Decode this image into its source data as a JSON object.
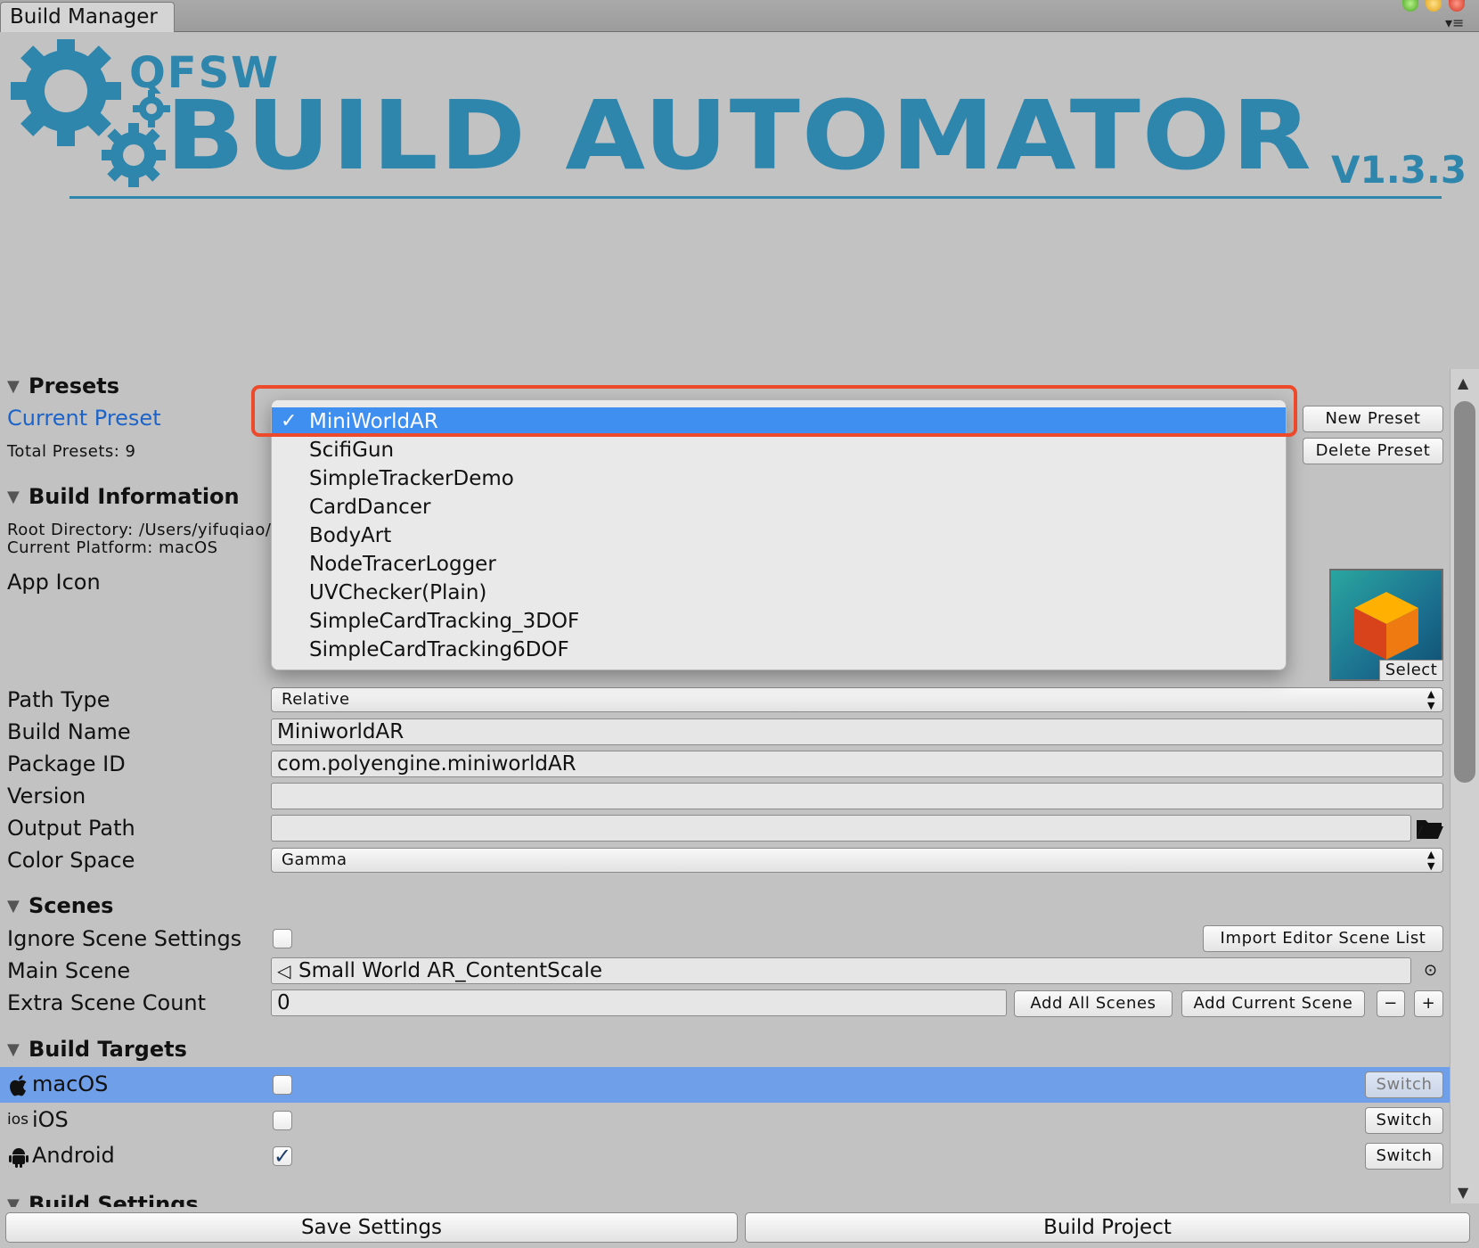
{
  "window": {
    "tab_title": "Build Manager",
    "menu_glyph": "▾≡"
  },
  "banner": {
    "brand": "QFSW",
    "title": "BUILD AUTOMATOR",
    "version": "V1.3.3",
    "color": "#2f86ad"
  },
  "presets": {
    "header": "Presets",
    "current_label": "Current Preset",
    "total_label": "Total Presets: 9",
    "new_button": "New Preset",
    "delete_button": "Delete Preset",
    "dropdown": {
      "selected": "MiniWorldAR",
      "check_glyph": "✓",
      "options": [
        "MiniWorldAR",
        "ScifiGun",
        "SimpleTrackerDemo",
        "CardDancer",
        "BodyArt",
        "NodeTracerLogger",
        "UVChecker(Plain)",
        "SimpleCardTracking_3DOF",
        "SimpleCardTracking6DOF"
      ],
      "highlight_color": "#3f8ff0",
      "callout_color": "#ec4a2b"
    }
  },
  "build_info": {
    "header": "Build Information",
    "root_directory": "Root Directory: /Users/yifuqiao/",
    "current_platform": "Current Platform: macOS",
    "app_icon_label": "App Icon",
    "app_icon_select": "Select"
  },
  "fields": {
    "path_type": {
      "label": "Path Type",
      "value": "Relative"
    },
    "build_name": {
      "label": "Build Name",
      "value": "MiniworldAR"
    },
    "package_id": {
      "label": "Package ID",
      "value": "com.polyengine.miniworldAR"
    },
    "version": {
      "label": "Version",
      "value": ""
    },
    "output_path": {
      "label": "Output Path",
      "value": ""
    },
    "color_space": {
      "label": "Color Space",
      "value": "Gamma"
    }
  },
  "scenes": {
    "header": "Scenes",
    "ignore_label": "Ignore Scene Settings",
    "ignore_checked": false,
    "import_button": "Import Editor Scene List",
    "main_scene_label": "Main Scene",
    "main_scene_value": "Small World AR_ContentScale",
    "extra_count_label": "Extra Scene Count",
    "extra_count_value": "0",
    "add_all_button": "Add All Scenes",
    "add_current_button": "Add Current Scene",
    "minus_button": "−",
    "plus_button": "+"
  },
  "build_targets": {
    "header": "Build Targets",
    "switch_label": "Switch",
    "selected_row_color": "#6f9fe8",
    "items": [
      {
        "name": "macOS",
        "icon": "apple-icon",
        "glyph": "",
        "checked": false,
        "selected": true
      },
      {
        "name": "iOS",
        "icon": "ios-icon",
        "glyph": "ios",
        "checked": false,
        "selected": false
      },
      {
        "name": "Android",
        "icon": "android-icon",
        "glyph": "",
        "checked": true,
        "selected": false
      }
    ]
  },
  "build_settings": {
    "header": "Build Settings"
  },
  "footer": {
    "save_button": "Save Settings",
    "build_button": "Build Project"
  }
}
